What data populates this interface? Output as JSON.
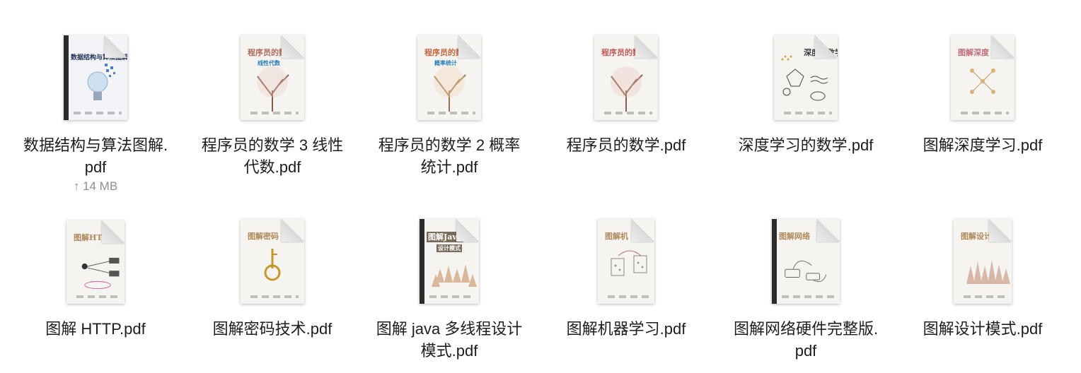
{
  "files": [
    {
      "name": "数据结构与算法图解.pdf",
      "meta": "↑ 14 MB",
      "cover_title": "数据结构与算法图解",
      "cover_sub": "",
      "cover_color": "#2a3a66"
    },
    {
      "name": "程序员的数学 3 线性代数.pdf",
      "cover_title": "程序员的数",
      "cover_sub": "线性代数",
      "cover_color": "#b06b5e"
    },
    {
      "name": "程序员的数学 2 概率统计.pdf",
      "cover_title": "程序员的数",
      "cover_sub": "概率统计",
      "cover_color": "#c2683c"
    },
    {
      "name": "程序员的数学.pdf",
      "cover_title": "程序员的数学",
      "cover_sub": "",
      "cover_color": "#c25a5a"
    },
    {
      "name": "深度学习的数学.pdf",
      "cover_title": "深度的数学",
      "cover_sub": "",
      "cover_color": "#3b3b3b"
    },
    {
      "name": "图解深度学习.pdf",
      "cover_title": "图解深度",
      "cover_sub": "",
      "cover_color": "#c26d7b"
    },
    {
      "name": "图解 HTTP.pdf",
      "cover_title": "图解HT",
      "cover_sub": "",
      "cover_color": "#b08a5c"
    },
    {
      "name": "图解密码技术.pdf",
      "cover_title": "图解密码",
      "cover_sub": "",
      "cover_color": "#b08a5c"
    },
    {
      "name": "图解 java 多线程设计模式.pdf",
      "cover_title": "图解Java",
      "cover_sub": "设计模式",
      "cover_color": "#5a5a5a"
    },
    {
      "name": "图解机器学习.pdf",
      "cover_title": "图解机",
      "cover_sub": "",
      "cover_color": "#b08a5c"
    },
    {
      "name": "图解网络硬件完整版.pdf",
      "cover_title": "图解网络",
      "cover_sub": "",
      "cover_color": "#b08a5c"
    },
    {
      "name": "图解设计模式.pdf",
      "cover_title": "图解设计",
      "cover_sub": "",
      "cover_color": "#b08a5c"
    }
  ]
}
